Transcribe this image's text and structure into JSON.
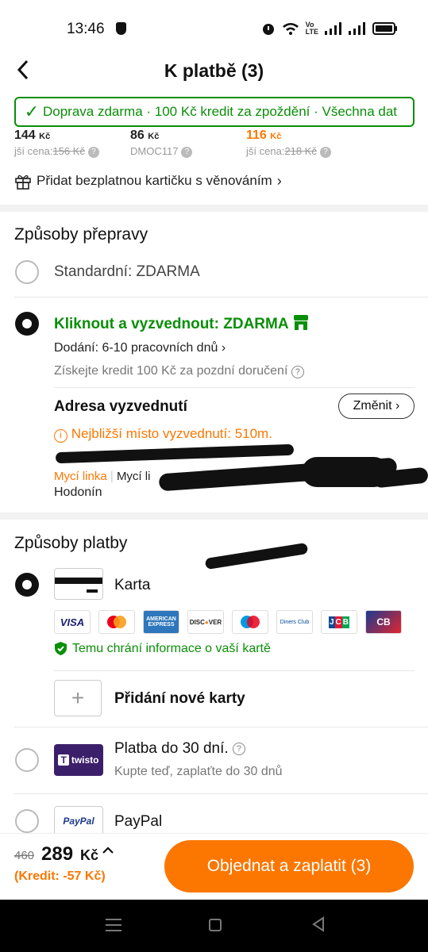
{
  "status": {
    "time": "13:46",
    "icons": [
      "shield-icon",
      "alarm-icon",
      "wifi-icon",
      "volte-icon",
      "signal-icon",
      "signal-icon",
      "battery-icon"
    ],
    "volte": "Vo\nLTE"
  },
  "header": {
    "title": "K platbě (3)"
  },
  "banner": {
    "text": "Doprava zdarma · 100 Kč kredit za zpoždění · Všechna dat"
  },
  "products": [
    {
      "price": "144",
      "currency": "Kč",
      "sub_label": "jší cena:",
      "old": "156 Kč"
    },
    {
      "price": "86",
      "currency": "Kč",
      "sub_label": "DMOC117"
    },
    {
      "price": "116",
      "currency": "Kč",
      "sub_label": "jší cena:",
      "old": "218 Kč"
    }
  ],
  "gift": {
    "label": "Přidat bezplatnou kartičku s věnováním"
  },
  "shipping": {
    "title": "Způsoby přepravy",
    "standard": "Standardní: ZDARMA",
    "pickup": "Kliknout a vyzvednout: ZDARMA",
    "delivery": "Dodání: 6-10 pracovních dnů",
    "credit_note": "Získejte kredit 100 Kč za pozdní doručení",
    "address_title": "Adresa vyzvednutí",
    "change": "Změnit",
    "nearest": "Nejbližší místo vyzvednutí: 510m.",
    "place_tag": "Mycí linka",
    "place_name": "Mycí li",
    "city": "Hodonín"
  },
  "payment": {
    "title": "Způsoby platby",
    "card": "Karta",
    "brands": [
      "VISA",
      "MC",
      "AMEX",
      "DISCOVER",
      "MAESTRO",
      "Diners Club",
      "JCB",
      "CB"
    ],
    "protect": "Temu chrání informace o vaší kartě",
    "add_card": "Přidání nové karty",
    "twisto_title": "Platba do 30 dní.",
    "twisto_sub": "Kupte teď, zaplaťte do 30 dnů",
    "twisto_logo": "twisto",
    "paypal": "PayPal",
    "paypal_logo": "PayPal"
  },
  "footer": {
    "old_price": "460",
    "price": "289",
    "currency": "Kč",
    "credit": "(Kredit: -57 Kč)",
    "order": "Objednat a zaplatit (3)"
  }
}
